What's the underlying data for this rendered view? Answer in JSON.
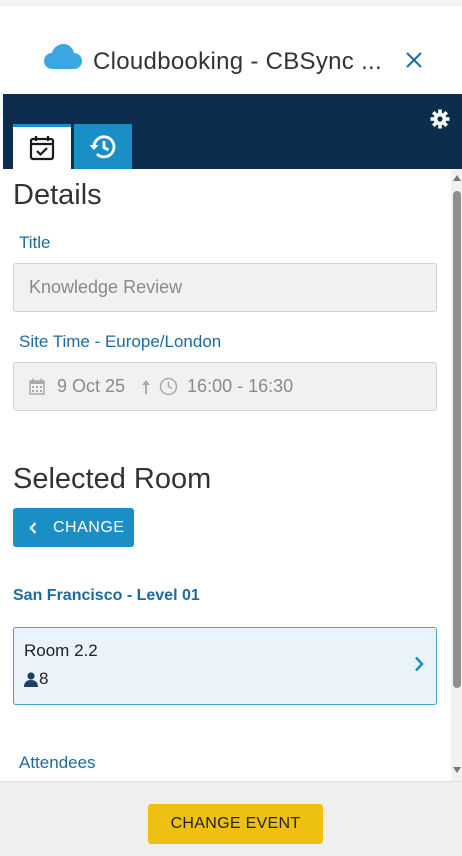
{
  "header": {
    "title": "Cloudbooking - CBSync ..."
  },
  "details": {
    "heading": "Details",
    "title_label": "Title",
    "title_value": "Knowledge Review",
    "time_label": "Site Time - Europe/London",
    "date": "9 Oct 25",
    "time_range": "16:00 - 16:30"
  },
  "room": {
    "heading": "Selected Room",
    "change_label": "CHANGE",
    "site": "San Francisco - Level 01",
    "name": "Room 2.2",
    "capacity": "8"
  },
  "attendees_label": "Attendees",
  "footer": {
    "button_label": "CHANGE EVENT"
  },
  "colors": {
    "navbar": "#0d2d4e",
    "accent": "#1b8fc5",
    "button": "#eec011",
    "label": "#1d6aa3"
  }
}
